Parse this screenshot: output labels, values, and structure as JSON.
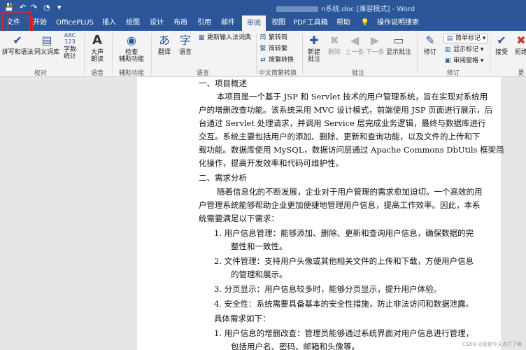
{
  "titlebar": {
    "quick_access": [
      "💾",
      "↶",
      "↷",
      "◔",
      "▾"
    ],
    "doc_title": "n系统.doc [兼容模式] - Word"
  },
  "tabs": [
    "文件",
    "开始",
    "OfficePLUS",
    "插入",
    "绘图",
    "设计",
    "布局",
    "引用",
    "邮件",
    "审阅",
    "视图",
    "PDF工具箱",
    "帮助",
    "操作说明搜索"
  ],
  "ribbon": {
    "proofing": {
      "spell": "拼写和语法",
      "thesaurus": "同义词库",
      "word_count_line1": "字数",
      "word_count_line2": "统计",
      "abc": "ABC",
      "num": "123",
      "group": "校对"
    },
    "speech": {
      "read_aloud_line1": "大声",
      "read_aloud_line2": "朗读",
      "group": "语音"
    },
    "accessibility": {
      "check_line1": "检查",
      "check_line2": "辅助功能",
      "group": "辅助功能"
    },
    "language": {
      "translate": "翻译",
      "language": "语言",
      "update_ime": "更新输入法词典",
      "group": "语言"
    },
    "chinese": {
      "to_simplified": "繁转简",
      "to_traditional": "简转繁",
      "convert": "简繁转换",
      "group": "中文简繁转换"
    },
    "comments": {
      "new_line1": "新建",
      "new_line2": "批注",
      "delete": "删除",
      "prev": "上一条",
      "next": "下一条",
      "show": "显示批注",
      "group": "批注"
    },
    "tracking": {
      "track": "修订",
      "simple_markup": "简单标记",
      "show_markup": "显示标记",
      "review_pane": "审阅窗格",
      "group": "修订"
    },
    "changes": {
      "accept": "接受",
      "reject": "拒绝",
      "group": "更"
    }
  },
  "document": {
    "lines": [
      "一、项目概述",
      "本项目是一个基于 JSP 和 Servlet 技术的用户管理系统，旨在实现对系统用",
      "户的增删改查功能。该系统采用 MVC 设计模式，前端使用 JSP 页面进行展示，后",
      "台通过 Servlet 处理请求，并调用 Service 层完成业务逻辑，最终与数据库进行",
      "交互。系统主要包括用户的添加、删除、更新和查询功能，以及文件的上传和下",
      "载功能。数据库使用 MySQL，数据访问层通过 Apache Commons DbUtils 框架简",
      "化操作，提高开发效率和代码可维护性。",
      "二、需求分析",
      "随着信息化的不断发展，企业对于用户管理的需求愈加迫切。一个高效的用",
      "户管理系统能够帮助企业更加便捷地管理用户信息，提高工作效率。因此，本系",
      "统需要满足以下需求：",
      "1.   用户信息管理：能够添加、删除、更新和查询用户信息，确保数据的完",
      "整性和一致性。",
      "2.   文件管理：支持用户头像或其他相关文件的上传和下载，方便用户信息",
      "的管理和展示。",
      "3.   分页显示：用户信息较多时，能够分页显示，提升用户体验。",
      "4.   安全性：系统需要具备基本的安全性措施，防止非法访问和数据泄露。",
      "具体需求如下：",
      "1.   用户信息的增删改查：管理员能够通过系统界面对用户信息进行管理，",
      "包括用户名、密码、邮箱和头像等。"
    ],
    "watermark": "CSDN @星星今天点打了嘛"
  }
}
